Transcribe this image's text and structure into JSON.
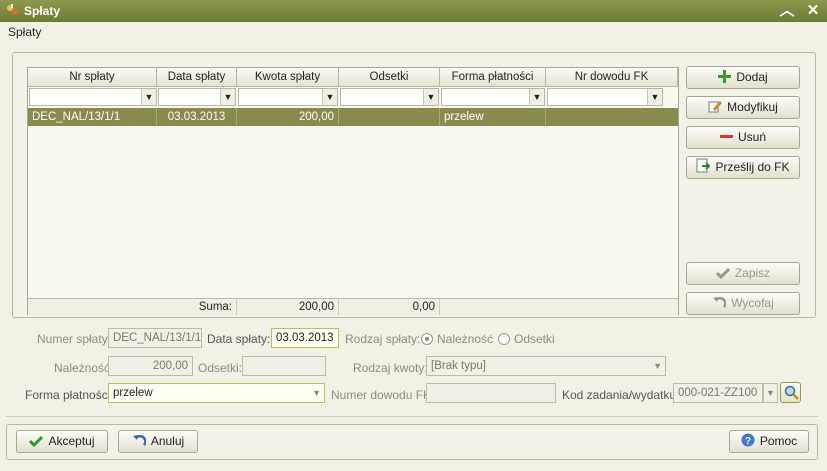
{
  "window": {
    "title": "Spłaty"
  },
  "menubar": {
    "label": "Spłaty"
  },
  "grid": {
    "columns": [
      "Nr spłaty",
      "Data spłaty",
      "Kwota spłaty",
      "Odsetki",
      "Forma płatności",
      "Nr dowodu FK"
    ],
    "rows": [
      {
        "nr": "DEC_NAL/13/1/1",
        "date": "03.03.2013",
        "amount": "200,00",
        "interest": "",
        "form": "przelew",
        "doc": ""
      }
    ],
    "sum_label": "Suma:",
    "sum_amount": "200,00",
    "sum_interest": "0,00"
  },
  "actions": {
    "add": "Dodaj",
    "modify": "Modyfikuj",
    "delete": "Usuń",
    "send": "Prześlij do FK",
    "save": "Zapisz",
    "revert": "Wycofaj"
  },
  "form": {
    "numer_label": "Numer spłaty:",
    "numer_value": "DEC_NAL/13/1/1",
    "data_label": "Data spłaty:",
    "data_value": "03.03.2013",
    "rodzaj_splaty_label": "Rodzaj spłaty:",
    "radio_naleznosc": "Należność",
    "radio_odsetki": "Odsetki",
    "naleznosc_label": "Należność:",
    "naleznosc_value": "200,00",
    "odsetki_label": "Odsetki:",
    "odsetki_value": "",
    "rodzaj_kwoty_label": "Rodzaj kwoty:",
    "rodzaj_kwoty_value": "[Brak typu]",
    "forma_label": "Forma płatności:",
    "forma_value": "przelew",
    "numer_dowodu_label": "Numer dowodu FK:",
    "numer_dowodu_value": "",
    "kod_label": "Kod zadania/wydatku:",
    "kod_value": "000-021-ZZ100"
  },
  "footer": {
    "accept": "Akceptuj",
    "cancel": "Anuluj",
    "help": "Pomoc"
  }
}
